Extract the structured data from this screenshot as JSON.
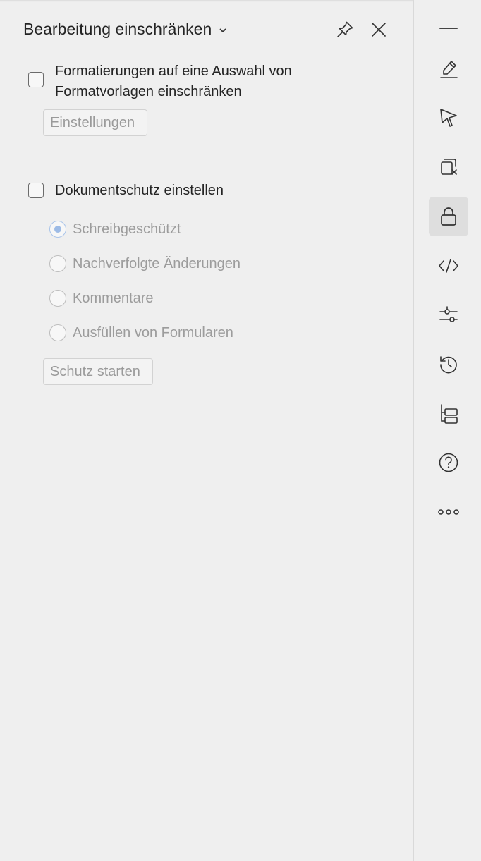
{
  "pane": {
    "title": "Bearbeitung einschränken",
    "formatting": {
      "checkbox_label": "Formatierungen auf eine Auswahl von Formatvorlagen einschränken",
      "checked": false,
      "settings_button": "Einstellungen"
    },
    "protection": {
      "checkbox_label": "Dokumentschutz einstellen",
      "checked": false,
      "options": [
        {
          "label": "Schreibgeschützt",
          "selected": true
        },
        {
          "label": "Nachverfolgte Änderungen",
          "selected": false
        },
        {
          "label": "Kommentare",
          "selected": false
        },
        {
          "label": "Ausfüllen von Formularen",
          "selected": false
        }
      ],
      "start_button": "Schutz starten"
    }
  },
  "rail": {
    "items": [
      {
        "icon": "minimize-icon"
      },
      {
        "icon": "highlighter-icon"
      },
      {
        "icon": "cursor-icon"
      },
      {
        "icon": "copy-remove-icon"
      },
      {
        "icon": "lock-icon",
        "active": true
      },
      {
        "icon": "code-icon"
      },
      {
        "icon": "sliders-icon"
      },
      {
        "icon": "history-icon"
      },
      {
        "icon": "tree-structure-icon"
      },
      {
        "icon": "help-icon"
      },
      {
        "icon": "more-icon"
      }
    ]
  },
  "colors": {
    "background": "#efefef",
    "text": "#242424",
    "disabled_text": "#9c9c9c",
    "radio_selected": "#9dbbe6",
    "active_rail": "#dedede"
  }
}
